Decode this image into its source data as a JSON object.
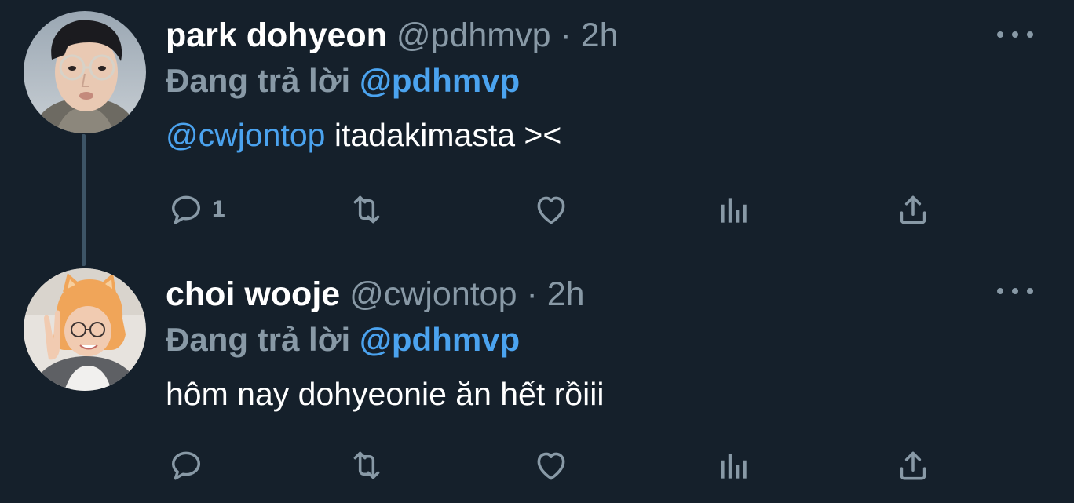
{
  "tweets": [
    {
      "display_name": "park dohyeon",
      "handle": "@pdhmvp",
      "separator": "·",
      "time": "2h",
      "reply_prefix": "Đang trả lời",
      "reply_to": "@pdhmvp",
      "text_mention": "@cwjontop",
      "text": " itadakimasta ><",
      "reply_count": "1",
      "avatar_icon": "avatar-glasses-man"
    },
    {
      "display_name": "choi wooje",
      "handle": "@cwjontop",
      "separator": "·",
      "time": "2h",
      "reply_prefix": "Đang trả lời",
      "reply_to": "@pdhmvp",
      "text": "hôm nay dohyeonie ăn hết rồiii",
      "reply_count": "",
      "avatar_icon": "avatar-cat-hat-person"
    }
  ],
  "icons": {
    "reply": "reply-icon",
    "retweet": "retweet-icon",
    "like": "heart-icon",
    "stats": "analytics-icon",
    "share": "share-icon",
    "more": "more-dots-icon"
  },
  "colors": {
    "background": "#15202b",
    "primary_text": "#ffffff",
    "secondary_text": "#8899a6",
    "accent": "#4ba3ef",
    "thread_line": "#3d5466"
  }
}
